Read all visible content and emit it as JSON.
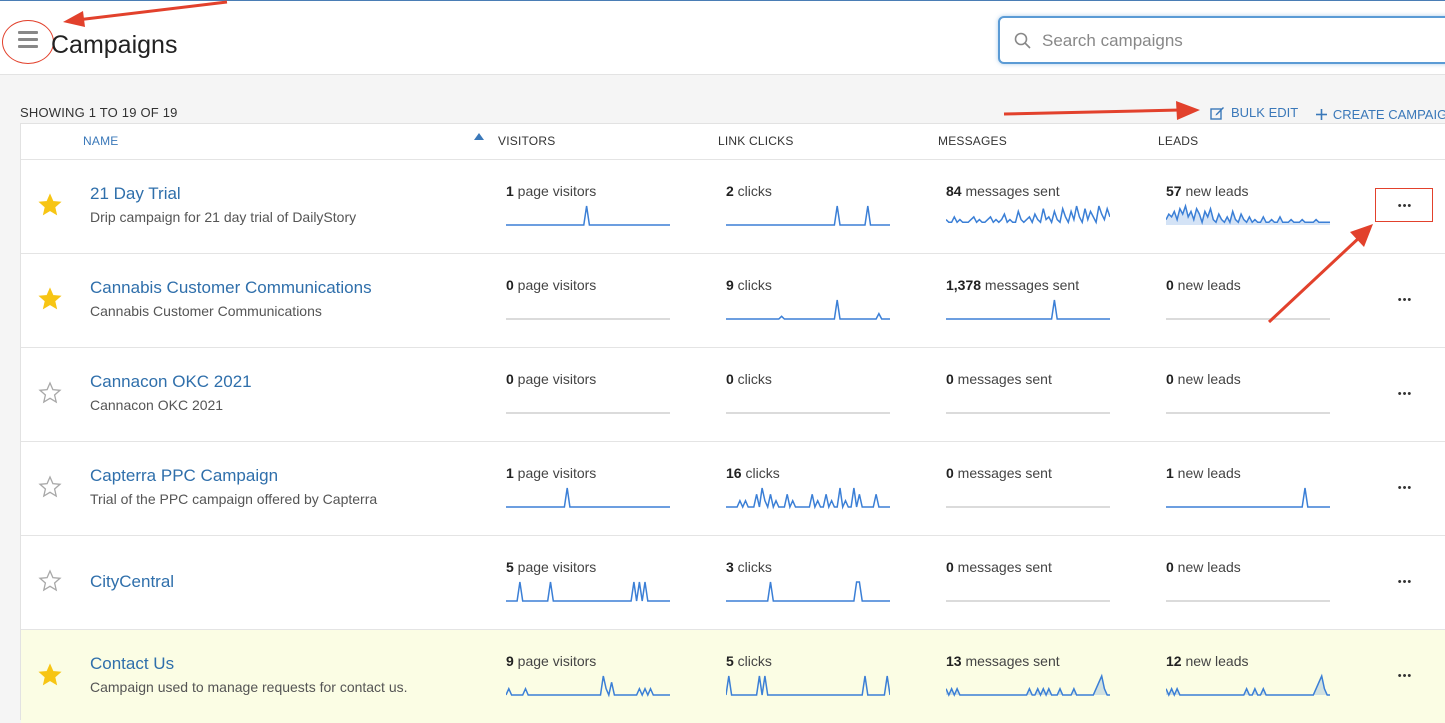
{
  "header": {
    "title": "Campaigns",
    "search": {
      "placeholder": "Search campaigns",
      "value": ""
    }
  },
  "toolbar": {
    "showing": "SHOWING 1 TO 19 OF 19",
    "bulk_edit": "BULK EDIT",
    "create": "CREATE CAMPAIGN"
  },
  "table": {
    "columns": {
      "name": "NAME",
      "visitors": "VISITORS",
      "link_clicks": "LINK CLICKS",
      "messages": "MESSAGES",
      "leads": "LEADS"
    },
    "rows": [
      {
        "starred": true,
        "highlight": false,
        "name": "21 Day Trial",
        "description": "Drip campaign for 21 day trial of DailyStory",
        "visitors": {
          "value": "1",
          "suffix": " page visitors",
          "spark": [
            0,
            0,
            0,
            0,
            0,
            0,
            0,
            0,
            0,
            0,
            0,
            0,
            0,
            0,
            0,
            0,
            0,
            0,
            0,
            0,
            0,
            0,
            0,
            0,
            0,
            0,
            0,
            0,
            0,
            1,
            0,
            0,
            0,
            0,
            0,
            0,
            0,
            0,
            0,
            0,
            0,
            0,
            0,
            0,
            0,
            0,
            0,
            0,
            0,
            0,
            0,
            0,
            0,
            0,
            0,
            0,
            0,
            0,
            0,
            0
          ]
        },
        "clicks": {
          "value": "2",
          "suffix": " clicks",
          "spark": [
            0,
            0,
            0,
            0,
            0,
            0,
            0,
            0,
            0,
            0,
            0,
            0,
            0,
            0,
            0,
            0,
            0,
            0,
            0,
            0,
            0,
            0,
            0,
            0,
            0,
            0,
            0,
            0,
            0,
            0,
            0,
            0,
            0,
            0,
            0,
            0,
            0,
            0,
            0,
            0,
            1,
            0,
            0,
            0,
            0,
            0,
            0,
            0,
            0,
            0,
            0,
            1,
            0,
            0,
            0,
            0,
            0,
            0,
            0,
            0
          ]
        },
        "messages": {
          "value": "84",
          "suffix": " messages sent",
          "spark": [
            2,
            1,
            1,
            3,
            1,
            2,
            1,
            1,
            1,
            2,
            3,
            1,
            2,
            1,
            1,
            2,
            3,
            1,
            2,
            1,
            2,
            4,
            1,
            2,
            1,
            1,
            5,
            2,
            1,
            2,
            3,
            1,
            4,
            2,
            1,
            6,
            2,
            3,
            1,
            5,
            2,
            1,
            6,
            3,
            1,
            5,
            2,
            7,
            3,
            1,
            6,
            2,
            5,
            3,
            1,
            7,
            4,
            2,
            6,
            3
          ]
        },
        "leads": {
          "value": "57",
          "suffix": " new leads",
          "fill": true,
          "spark": [
            2,
            4,
            3,
            5,
            2,
            6,
            4,
            7,
            3,
            5,
            2,
            6,
            4,
            1,
            5,
            3,
            6,
            2,
            1,
            4,
            2,
            1,
            3,
            1,
            5,
            2,
            1,
            4,
            2,
            1,
            3,
            1,
            2,
            1,
            1,
            3,
            1,
            1,
            2,
            1,
            1,
            3,
            1,
            1,
            1,
            2,
            1,
            1,
            1,
            2,
            1,
            1,
            1,
            1,
            2,
            1,
            1,
            1,
            1,
            1
          ]
        }
      },
      {
        "starred": true,
        "highlight": false,
        "name": "Cannabis Customer Communications",
        "description": "Cannabis Customer Communications",
        "visitors": {
          "value": "0",
          "suffix": " page visitors",
          "spark": []
        },
        "clicks": {
          "value": "9",
          "suffix": " clicks",
          "spark": [
            0,
            0,
            0,
            0,
            0,
            0,
            0,
            0,
            0,
            0,
            0,
            0,
            0,
            0,
            0,
            0,
            0,
            0,
            0,
            0,
            1,
            0,
            0,
            0,
            0,
            0,
            0,
            0,
            0,
            0,
            0,
            0,
            0,
            0,
            0,
            0,
            0,
            0,
            0,
            0,
            7,
            0,
            0,
            0,
            0,
            0,
            0,
            0,
            0,
            0,
            0,
            0,
            0,
            0,
            0,
            2,
            0,
            0,
            0,
            0
          ]
        },
        "messages": {
          "value": "1,378",
          "suffix": " messages sent",
          "spark": [
            0,
            0,
            0,
            0,
            0,
            0,
            0,
            0,
            0,
            0,
            0,
            0,
            0,
            0,
            0,
            0,
            0,
            0,
            0,
            0,
            0,
            0,
            0,
            0,
            0,
            0,
            0,
            0,
            0,
            0,
            0,
            0,
            0,
            0,
            0,
            0,
            0,
            0,
            0,
            1,
            0,
            0,
            0,
            0,
            0,
            0,
            0,
            0,
            0,
            0,
            0,
            0,
            0,
            0,
            0,
            0,
            0,
            0,
            0,
            0
          ]
        },
        "leads": {
          "value": "0",
          "suffix": " new leads",
          "spark": []
        }
      },
      {
        "starred": false,
        "highlight": false,
        "name": "Cannacon OKC 2021",
        "description": "Cannacon OKC 2021",
        "visitors": {
          "value": "0",
          "suffix": " page visitors",
          "spark": []
        },
        "clicks": {
          "value": "0",
          "suffix": " clicks",
          "spark": []
        },
        "messages": {
          "value": "0",
          "suffix": " messages sent",
          "spark": []
        },
        "leads": {
          "value": "0",
          "suffix": " new leads",
          "spark": []
        }
      },
      {
        "starred": false,
        "highlight": false,
        "name": "Capterra PPC Campaign",
        "description": "Trial of the PPC campaign offered by Capterra",
        "visitors": {
          "value": "1",
          "suffix": " page visitors",
          "spark": [
            0,
            0,
            0,
            0,
            0,
            0,
            0,
            0,
            0,
            0,
            0,
            0,
            0,
            0,
            0,
            0,
            0,
            0,
            0,
            0,
            0,
            0,
            1,
            0,
            0,
            0,
            0,
            0,
            0,
            0,
            0,
            0,
            0,
            0,
            0,
            0,
            0,
            0,
            0,
            0,
            0,
            0,
            0,
            0,
            0,
            0,
            0,
            0,
            0,
            0,
            0,
            0,
            0,
            0,
            0,
            0,
            0,
            0,
            0,
            0
          ]
        },
        "clicks": {
          "value": "16",
          "suffix": " clicks",
          "spark": [
            0,
            0,
            0,
            0,
            0,
            1,
            0,
            1,
            0,
            0,
            0,
            2,
            0,
            3,
            1,
            0,
            2,
            0,
            1,
            0,
            0,
            0,
            2,
            0,
            1,
            0,
            0,
            0,
            0,
            0,
            0,
            2,
            0,
            1,
            0,
            0,
            2,
            0,
            1,
            0,
            0,
            3,
            0,
            1,
            0,
            0,
            3,
            0,
            2,
            0,
            0,
            0,
            0,
            0,
            2,
            0,
            0,
            0,
            0,
            0
          ]
        },
        "messages": {
          "value": "0",
          "suffix": " messages sent",
          "spark": []
        },
        "leads": {
          "value": "1",
          "suffix": " new leads",
          "spark": [
            0,
            0,
            0,
            0,
            0,
            0,
            0,
            0,
            0,
            0,
            0,
            0,
            0,
            0,
            0,
            0,
            0,
            0,
            0,
            0,
            0,
            0,
            0,
            0,
            0,
            0,
            0,
            0,
            0,
            0,
            0,
            0,
            0,
            0,
            0,
            0,
            0,
            0,
            0,
            0,
            0,
            0,
            0,
            0,
            0,
            0,
            0,
            0,
            0,
            0,
            1,
            0,
            0,
            0,
            0,
            0,
            0,
            0,
            0,
            0
          ]
        }
      },
      {
        "starred": false,
        "highlight": false,
        "name": "CityCentral",
        "description": "",
        "visitors": {
          "value": "5",
          "suffix": " page visitors",
          "spark": [
            0,
            0,
            0,
            0,
            0,
            1,
            0,
            0,
            0,
            0,
            0,
            0,
            0,
            0,
            0,
            0,
            1,
            0,
            0,
            0,
            0,
            0,
            0,
            0,
            0,
            0,
            0,
            0,
            0,
            0,
            0,
            0,
            0,
            0,
            0,
            0,
            0,
            0,
            0,
            0,
            0,
            0,
            0,
            0,
            0,
            0,
            1,
            0,
            1,
            0,
            1,
            0,
            0,
            0,
            0,
            0,
            0,
            0,
            0,
            0
          ]
        },
        "clicks": {
          "value": "3",
          "suffix": " clicks",
          "spark": [
            0,
            0,
            0,
            0,
            0,
            0,
            0,
            0,
            0,
            0,
            0,
            0,
            0,
            0,
            0,
            0,
            1,
            0,
            0,
            0,
            0,
            0,
            0,
            0,
            0,
            0,
            0,
            0,
            0,
            0,
            0,
            0,
            0,
            0,
            0,
            0,
            0,
            0,
            0,
            0,
            0,
            0,
            0,
            0,
            0,
            0,
            0,
            1,
            1,
            0,
            0,
            0,
            0,
            0,
            0,
            0,
            0,
            0,
            0,
            0
          ]
        },
        "messages": {
          "value": "0",
          "suffix": " messages sent",
          "spark": []
        },
        "leads": {
          "value": "0",
          "suffix": " new leads",
          "spark": []
        }
      },
      {
        "starred": true,
        "highlight": true,
        "name": "Contact Us",
        "description": "Campaign used to manage requests for contact us.",
        "visitors": {
          "value": "9",
          "suffix": " page visitors",
          "spark": [
            0,
            1,
            0,
            0,
            0,
            0,
            0,
            1,
            0,
            0,
            0,
            0,
            0,
            0,
            0,
            0,
            0,
            0,
            0,
            0,
            0,
            0,
            0,
            0,
            0,
            0,
            0,
            0,
            0,
            0,
            0,
            0,
            0,
            0,
            0,
            3,
            1,
            0,
            2,
            0,
            0,
            0,
            0,
            0,
            0,
            0,
            0,
            0,
            1,
            0,
            1,
            0,
            1,
            0,
            0,
            0,
            0,
            0,
            0,
            0
          ]
        },
        "clicks": {
          "value": "5",
          "suffix": " clicks",
          "spark": [
            0,
            1,
            0,
            0,
            0,
            0,
            0,
            0,
            0,
            0,
            0,
            0,
            1,
            0,
            1,
            0,
            0,
            0,
            0,
            0,
            0,
            0,
            0,
            0,
            0,
            0,
            0,
            0,
            0,
            0,
            0,
            0,
            0,
            0,
            0,
            0,
            0,
            0,
            0,
            0,
            0,
            0,
            0,
            0,
            0,
            0,
            0,
            0,
            0,
            0,
            1,
            0,
            0,
            0,
            0,
            0,
            0,
            0,
            1,
            0
          ]
        },
        "messages": {
          "value": "13",
          "suffix": " messages sent",
          "fill": true,
          "spark": [
            1,
            0,
            1,
            0,
            1,
            0,
            0,
            0,
            0,
            0,
            0,
            0,
            0,
            0,
            0,
            0,
            0,
            0,
            0,
            0,
            0,
            0,
            0,
            0,
            0,
            0,
            0,
            0,
            0,
            0,
            1,
            0,
            0,
            1,
            0,
            1,
            0,
            1,
            0,
            0,
            0,
            1,
            0,
            0,
            0,
            0,
            1,
            0,
            0,
            0,
            0,
            0,
            0,
            0,
            1,
            2,
            3,
            1,
            0,
            0
          ]
        },
        "leads": {
          "value": "12",
          "suffix": " new leads",
          "fill": true,
          "spark": [
            1,
            0,
            1,
            0,
            1,
            0,
            0,
            0,
            0,
            0,
            0,
            0,
            0,
            0,
            0,
            0,
            0,
            0,
            0,
            0,
            0,
            0,
            0,
            0,
            0,
            0,
            0,
            0,
            0,
            1,
            0,
            0,
            1,
            0,
            0,
            1,
            0,
            0,
            0,
            0,
            0,
            0,
            0,
            0,
            0,
            0,
            0,
            0,
            0,
            0,
            0,
            0,
            0,
            0,
            1,
            2,
            3,
            1,
            0,
            0
          ]
        }
      }
    ]
  },
  "colors": {
    "accent": "#3a78b9",
    "spark": "#3b7fd6",
    "star_on": "#f7c514",
    "annotation": "#e2412c"
  }
}
